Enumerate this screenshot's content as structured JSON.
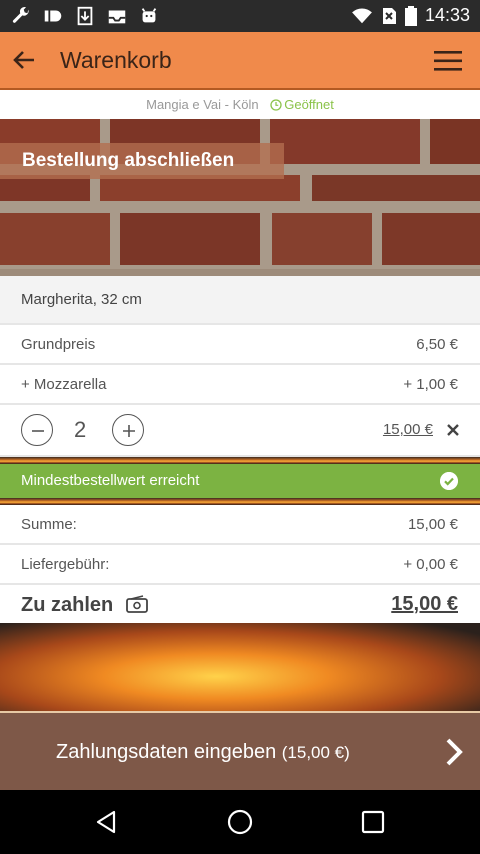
{
  "status_bar": {
    "time": "14:33",
    "icons": [
      "wrench-icon",
      "id-icon",
      "download-icon",
      "inbox-icon",
      "android-icon",
      "wifi-icon",
      "no-sim-icon",
      "battery-icon"
    ]
  },
  "app_bar": {
    "title": "Warenkorb",
    "back_icon": "arrow-left-icon",
    "menu_icon": "hamburger-menu-icon",
    "color": "#f08a4b"
  },
  "restaurant": {
    "name": "Mangia e Vai - Köln",
    "status": "Geöffnet",
    "status_color": "#8bc34a"
  },
  "hero": {
    "title": "Bestellung abschließen"
  },
  "item": {
    "name": "Margherita, 32 cm",
    "lines": [
      {
        "label": "Grundpreis",
        "value": "6,50 €"
      },
      {
        "label": "+ Mozzarella",
        "value": "+ 1,00 €"
      }
    ],
    "quantity": "2",
    "total": "15,00 €"
  },
  "min_order": {
    "text": "Mindestbestellwert erreicht",
    "color": "#7cb342"
  },
  "summary": {
    "sum_label": "Summe:",
    "sum_value": "15,00 €",
    "fee_label": "Liefergebühr:",
    "fee_value": "+ 0,00 €",
    "total_label": "Zu zahlen",
    "total_value": "15,00 €"
  },
  "cta": {
    "label": "Zahlungsdaten eingeben",
    "amount": "(15,00 €)",
    "color": "#7e5848"
  },
  "nav": {
    "icons": [
      "back-triangle-icon",
      "home-circle-icon",
      "recent-square-icon"
    ]
  }
}
